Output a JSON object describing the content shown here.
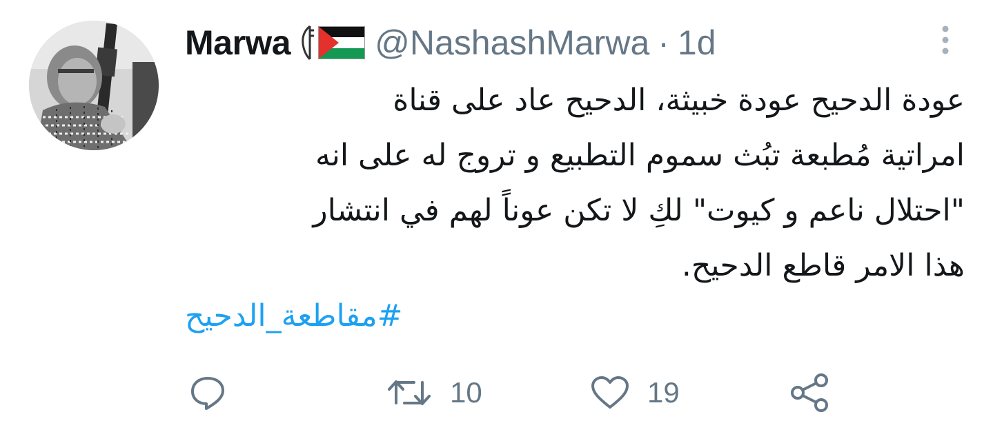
{
  "tweet": {
    "author": {
      "display_name": "Marwa",
      "name_decor": "key-icon and palestine-flag-icon",
      "handle": "@NashashMarwa",
      "separator": "·",
      "time": "1d"
    },
    "text_lines": [
      "عودة الدحيح عودة خبيثة، الدحيح عاد على قناة",
      "امراتية مُطبعة تبُث سموم التطبيع و تروج له على انه",
      "\"احتلال ناعم و كيوت\" لكِ لا تكن عوناً لهم في انتشار",
      "هذا الامر قاطع الدحيح."
    ],
    "hashtag": "#مقاطعة_الدحيح",
    "actions": {
      "reply_count": "",
      "retweet_count": "10",
      "like_count": "19"
    },
    "icons": {
      "more": "more-vertical-icon",
      "reply": "reply-icon",
      "retweet": "retweet-icon",
      "like": "heart-icon",
      "share": "share-icon"
    },
    "colors": {
      "text": "#14171a",
      "secondary": "#657786",
      "link": "#1da1f2"
    }
  }
}
